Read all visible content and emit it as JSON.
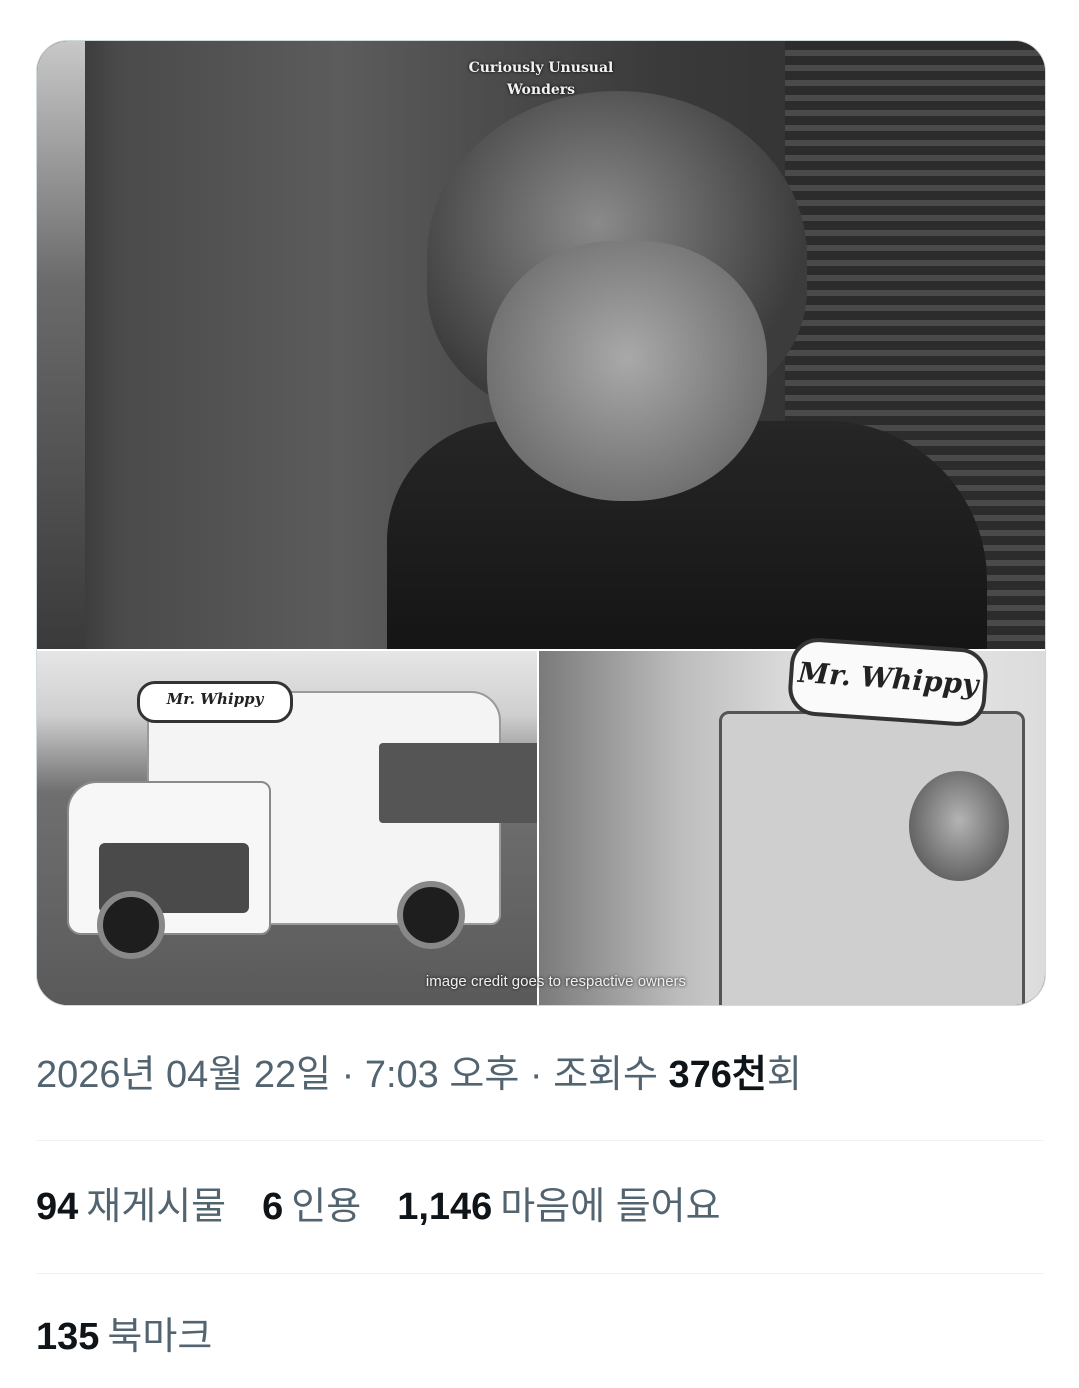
{
  "media": {
    "watermark_line1": "Curiously Unusual",
    "watermark_line2": "Wonders",
    "van_sign_small": "Mr. Whippy",
    "van_sign_large": "Mr. Whippy",
    "credit": "image credit goes to respactive owners"
  },
  "meta": {
    "date": "2026년 04월 22일",
    "separator": " · ",
    "time": "7:03 오후",
    "views_label": "조회수",
    "views_number": "376천",
    "views_suffix": "회"
  },
  "stats": {
    "reposts_count": "94",
    "reposts_label": "재게시물",
    "quotes_count": "6",
    "quotes_label": "인용",
    "likes_count": "1,146",
    "likes_label": "마음에 들어요"
  },
  "bookmarks": {
    "count": "135",
    "label": "북마크"
  }
}
